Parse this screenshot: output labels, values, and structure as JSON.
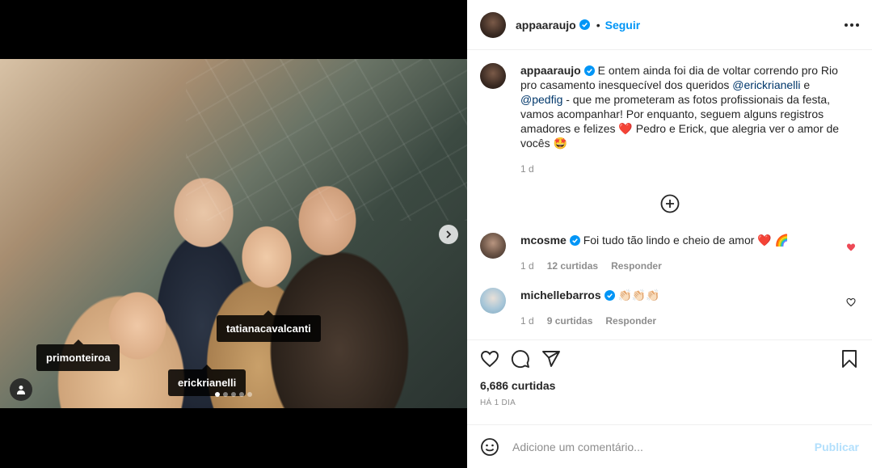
{
  "media": {
    "tags": {
      "primonteiroa": "primonteiroa",
      "tatianacavalcanti": "tatianacavalcanti",
      "erickrianelli": "erickrianelli"
    },
    "carousel": {
      "count": 5,
      "active": 1
    }
  },
  "header": {
    "username": "appaaraujo",
    "separator": "•",
    "follow_label": "Seguir"
  },
  "caption": {
    "username": "appaaraujo",
    "text_1": " E ontem ainda foi dia de voltar correndo pro Rio pro casamento inesquecível dos queridos ",
    "mention_1": "@erickrianelli",
    "text_2": " e ",
    "mention_2": "@pedfig",
    "text_3": " - que me prometeram as fotos profissionais da festa, vamos acompanhar! Por enquanto, seguem alguns registros amadores e felizes ",
    "emoji_heart": "❤️",
    "text_4": " Pedro e Erick, que alegria ver o amor de vocês ",
    "emoji_face": "🤩",
    "time": "1 d"
  },
  "comments": [
    {
      "username": "mcosme",
      "text": " Foi tudo tão lindo e cheio de amor ",
      "emoji": "❤️ 🌈",
      "time": "1 d",
      "likes": "12 curtidas",
      "reply": "Responder",
      "liked": true
    },
    {
      "username": "michellebarros",
      "text": " ",
      "emoji": "👏🏻👏🏻👏🏻",
      "time": "1 d",
      "likes": "9 curtidas",
      "reply": "Responder",
      "liked": false
    }
  ],
  "footer": {
    "likes": "6,686 curtidas",
    "posted": "HÁ 1 DIA",
    "comment_placeholder": "Adicione um comentário...",
    "publish_label": "Publicar"
  },
  "colors": {
    "accent": "#0095f6",
    "verified": "#0095f6",
    "like_red": "#ed4956",
    "muted": "#8e8e8e"
  }
}
